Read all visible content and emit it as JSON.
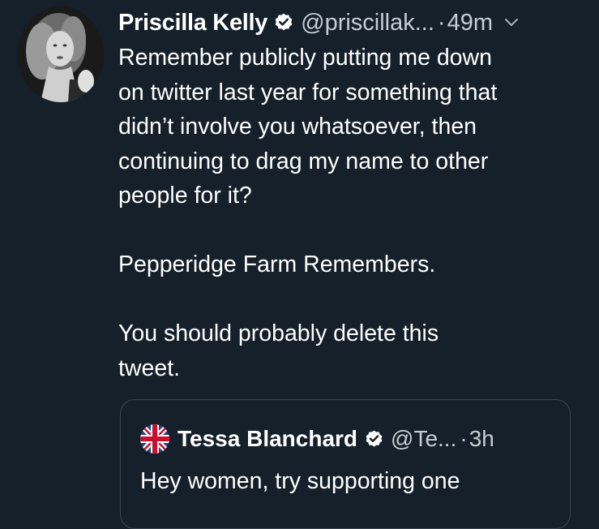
{
  "tweet": {
    "author": {
      "display_name": "Priscilla Kelly",
      "handle": "@priscillak...",
      "avatar_icon": "profile-photo"
    },
    "separator": "·",
    "timestamp": "49m",
    "text": "Remember publicly putting me down\non twitter last year for something that\ndidn’t involve you whatsoever, then\ncontinuing to drag my name to other\npeople for it?\n\nPepperidge Farm Remembers.\n\nYou should probably delete this\ntweet."
  },
  "quoted_tweet": {
    "author": {
      "display_name": "Tessa Blanchard",
      "handle": "@Te...",
      "avatar_icon": "union-jack-avatar"
    },
    "separator": "·",
    "timestamp": "3h",
    "text": "Hey women, try supporting one"
  },
  "colors": {
    "background": "#15202b",
    "text": "#ffffff",
    "secondary_text": "#c8cdd2",
    "border": "#3a4652"
  }
}
